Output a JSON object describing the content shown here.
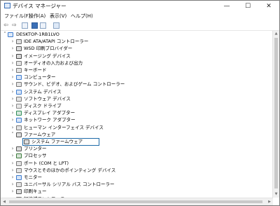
{
  "window": {
    "title": "デバイス マネージャー",
    "minimize": "—",
    "maximize": "☐",
    "close": "✕"
  },
  "menu": [
    "ファイル(F)",
    "操作(A)",
    "表示(V)",
    "ヘルプ(H)"
  ],
  "toolbar_icons": [
    "back-arrow-icon",
    "forward-arrow-icon",
    "properties-icon",
    "help-icon",
    "scan-icon",
    "monitor-icon"
  ],
  "tree": {
    "root": "DESKTOP-1RB1LVO",
    "items": [
      {
        "label": "IDE ATA/ATAPI コントローラー",
        "expanded": false,
        "icon": "ide-controller-icon",
        "color": "#6b6b6b"
      },
      {
        "label": "WSD 印刷プロバイダー",
        "expanded": false,
        "icon": "printer-icon",
        "color": "#555555"
      },
      {
        "label": "イメージング デバイス",
        "expanded": false,
        "icon": "camera-icon",
        "color": "#444444"
      },
      {
        "label": "オーディオの入力および出力",
        "expanded": false,
        "icon": "speaker-icon",
        "color": "#777777"
      },
      {
        "label": "キーボード",
        "expanded": false,
        "icon": "keyboard-icon",
        "color": "#777777"
      },
      {
        "label": "コンピューター",
        "expanded": false,
        "icon": "computer-icon",
        "color": "#3b7bd0"
      },
      {
        "label": "サウンド、ビデオ、およびゲーム コントローラー",
        "expanded": false,
        "icon": "sound-icon",
        "color": "#777777"
      },
      {
        "label": "システム デバイス",
        "expanded": false,
        "icon": "system-device-icon",
        "color": "#3b7bd0"
      },
      {
        "label": "ソフトウェア デバイス",
        "expanded": false,
        "icon": "software-device-icon",
        "color": "#777777"
      },
      {
        "label": "ディスク ドライブ",
        "expanded": false,
        "icon": "disk-drive-icon",
        "color": "#888888"
      },
      {
        "label": "ディスプレイ アダプター",
        "expanded": false,
        "icon": "display-adapter-icon",
        "color": "#2e8b57"
      },
      {
        "label": "ネットワーク アダプター",
        "expanded": false,
        "icon": "network-adapter-icon",
        "color": "#3b7bd0"
      },
      {
        "label": "ヒューマン インターフェイス デバイス",
        "expanded": false,
        "icon": "hid-icon",
        "color": "#777777"
      },
      {
        "label": "ファームウェア",
        "expanded": true,
        "icon": "firmware-icon",
        "color": "#555555"
      },
      {
        "label": "システム ファームウェア",
        "child": true,
        "selected": true,
        "icon": "firmware-icon",
        "color": "#555555"
      },
      {
        "label": "プリンター",
        "expanded": false,
        "icon": "printer-icon",
        "color": "#555555"
      },
      {
        "label": "プロセッサ",
        "expanded": false,
        "icon": "processor-icon",
        "color": "#3a7a3a"
      },
      {
        "label": "ポート (COM と LPT)",
        "expanded": false,
        "icon": "port-icon",
        "color": "#777777"
      },
      {
        "label": "マウスとそのほかのポインティング デバイス",
        "expanded": false,
        "icon": "mouse-icon",
        "color": "#777777"
      },
      {
        "label": "モニター",
        "expanded": false,
        "icon": "monitor-icon",
        "color": "#3b7bd0"
      },
      {
        "label": "ユニバーサル シリアル バス コントローラー",
        "expanded": false,
        "icon": "usb-icon",
        "color": "#777777"
      },
      {
        "label": "印刷キュー",
        "expanded": false,
        "icon": "print-queue-icon",
        "color": "#555555"
      },
      {
        "label": "記憶域コントローラー",
        "expanded": false,
        "icon": "storage-controller-icon",
        "color": "#777777"
      }
    ]
  },
  "colors": {
    "selection_border": "#1d6aa8",
    "accent": "#3b7bd0"
  }
}
